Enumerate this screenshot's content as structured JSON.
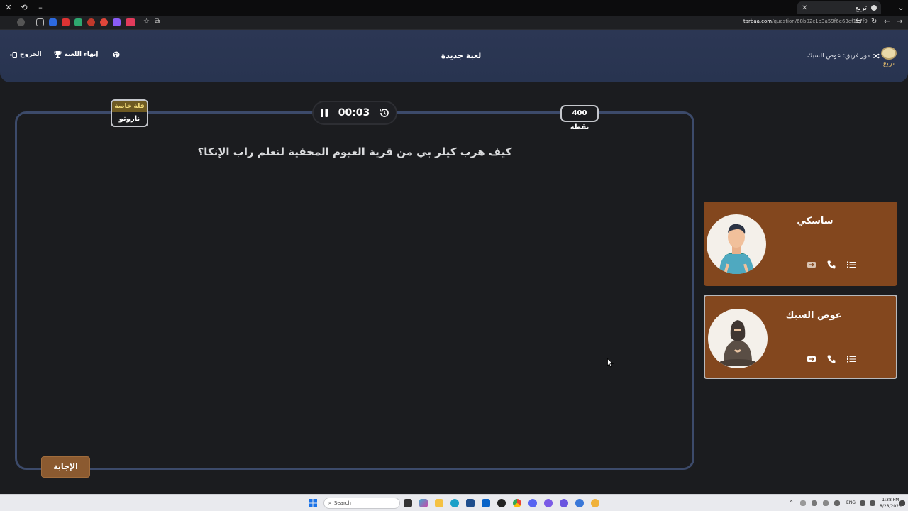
{
  "browser": {
    "tab_title": "تربع",
    "url_domain": "tarbaa.com",
    "url_path": "/question/68b02c1b3a59f6e63ef1e7f9"
  },
  "header": {
    "logo_text": "تربع",
    "team_turn": "دور فريق: عوض السبك",
    "title": "لعبة جديدة",
    "end_game_label": "إنهاء اللعبة",
    "exit_label": "الخروج"
  },
  "question": {
    "category_tag": "فلة خاصة",
    "category": "ناروتو",
    "timer": "00:03",
    "points": "400 نقطة",
    "text": "كيف هرب كيلر بي من قرية الغيوم المخفية لتعلم راب الإنكا؟",
    "answer_label": "الإجابة"
  },
  "teams": [
    {
      "name": "ساسكي",
      "avatar": "man-avatar",
      "active": false
    },
    {
      "name": "عوض السبك",
      "avatar": "woman-niqab-avatar",
      "active": true
    }
  ],
  "taskbar": {
    "search_placeholder": "Search",
    "lang": "ENG",
    "time": "1:38 PM",
    "date": "8/28/2025"
  },
  "colors": {
    "header_bg": "#2c3754",
    "board_border": "#3c4a6a",
    "card_bg": "#83471e",
    "answer_bg": "#8b5a30",
    "category_tag_bg": "#6e5a22"
  }
}
